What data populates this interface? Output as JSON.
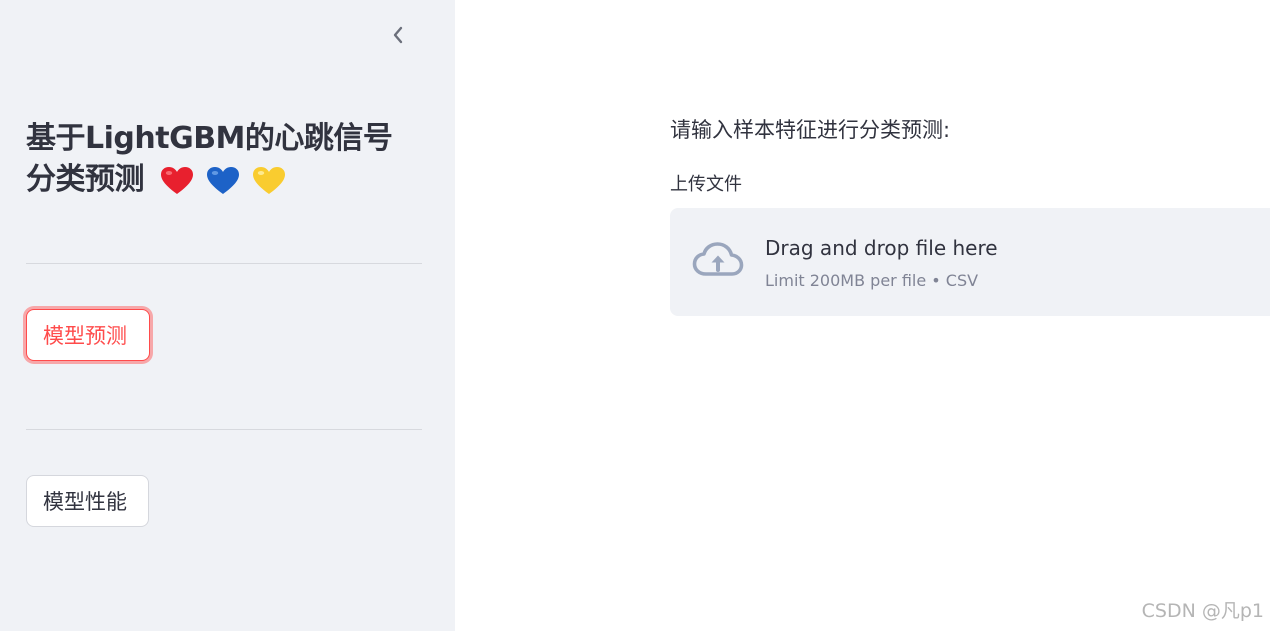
{
  "sidebar": {
    "collapse_icon": "chevron-left-icon",
    "title_line1": "基于LightGBM的心跳信号",
    "title_line2": "分类预测",
    "emojis": [
      "red-heart-icon",
      "blue-heart-icon",
      "yellow-heart-icon"
    ],
    "nav": [
      {
        "label": "模型预测",
        "active": true
      },
      {
        "label": "模型性能",
        "active": false
      }
    ]
  },
  "main": {
    "prompt": "请输入样本特征进行分类预测:",
    "uploader": {
      "label": "上传文件",
      "icon": "cloud-upload-icon",
      "title": "Drag and drop file here",
      "subtitle": "Limit 200MB per file • CSV"
    }
  },
  "watermark": "CSDN @凡p1",
  "colors": {
    "sidebar_bg": "#f0f2f6",
    "accent": "#ff4b4b",
    "text": "#31333f",
    "muted": "#808495",
    "heart_red": "#e8202e",
    "heart_blue": "#1d62c7",
    "heart_yellow": "#f9cc2f"
  }
}
